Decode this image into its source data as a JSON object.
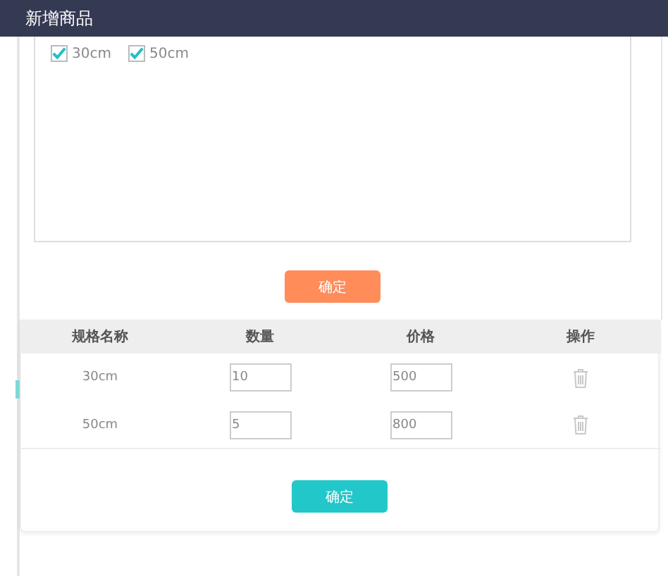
{
  "window": {
    "title": "新增商品"
  },
  "options": [
    {
      "label": "30cm",
      "checked": true
    },
    {
      "label": "50cm",
      "checked": true
    }
  ],
  "confirm_top": "确定",
  "table": {
    "columns": [
      "规格名称",
      "数量",
      "价格",
      "操作"
    ],
    "rows": [
      {
        "name": "30cm",
        "quantity": "10",
        "price": "500"
      },
      {
        "name": "50cm",
        "quantity": "5",
        "price": "800"
      }
    ]
  },
  "confirm_bottom": "确定"
}
